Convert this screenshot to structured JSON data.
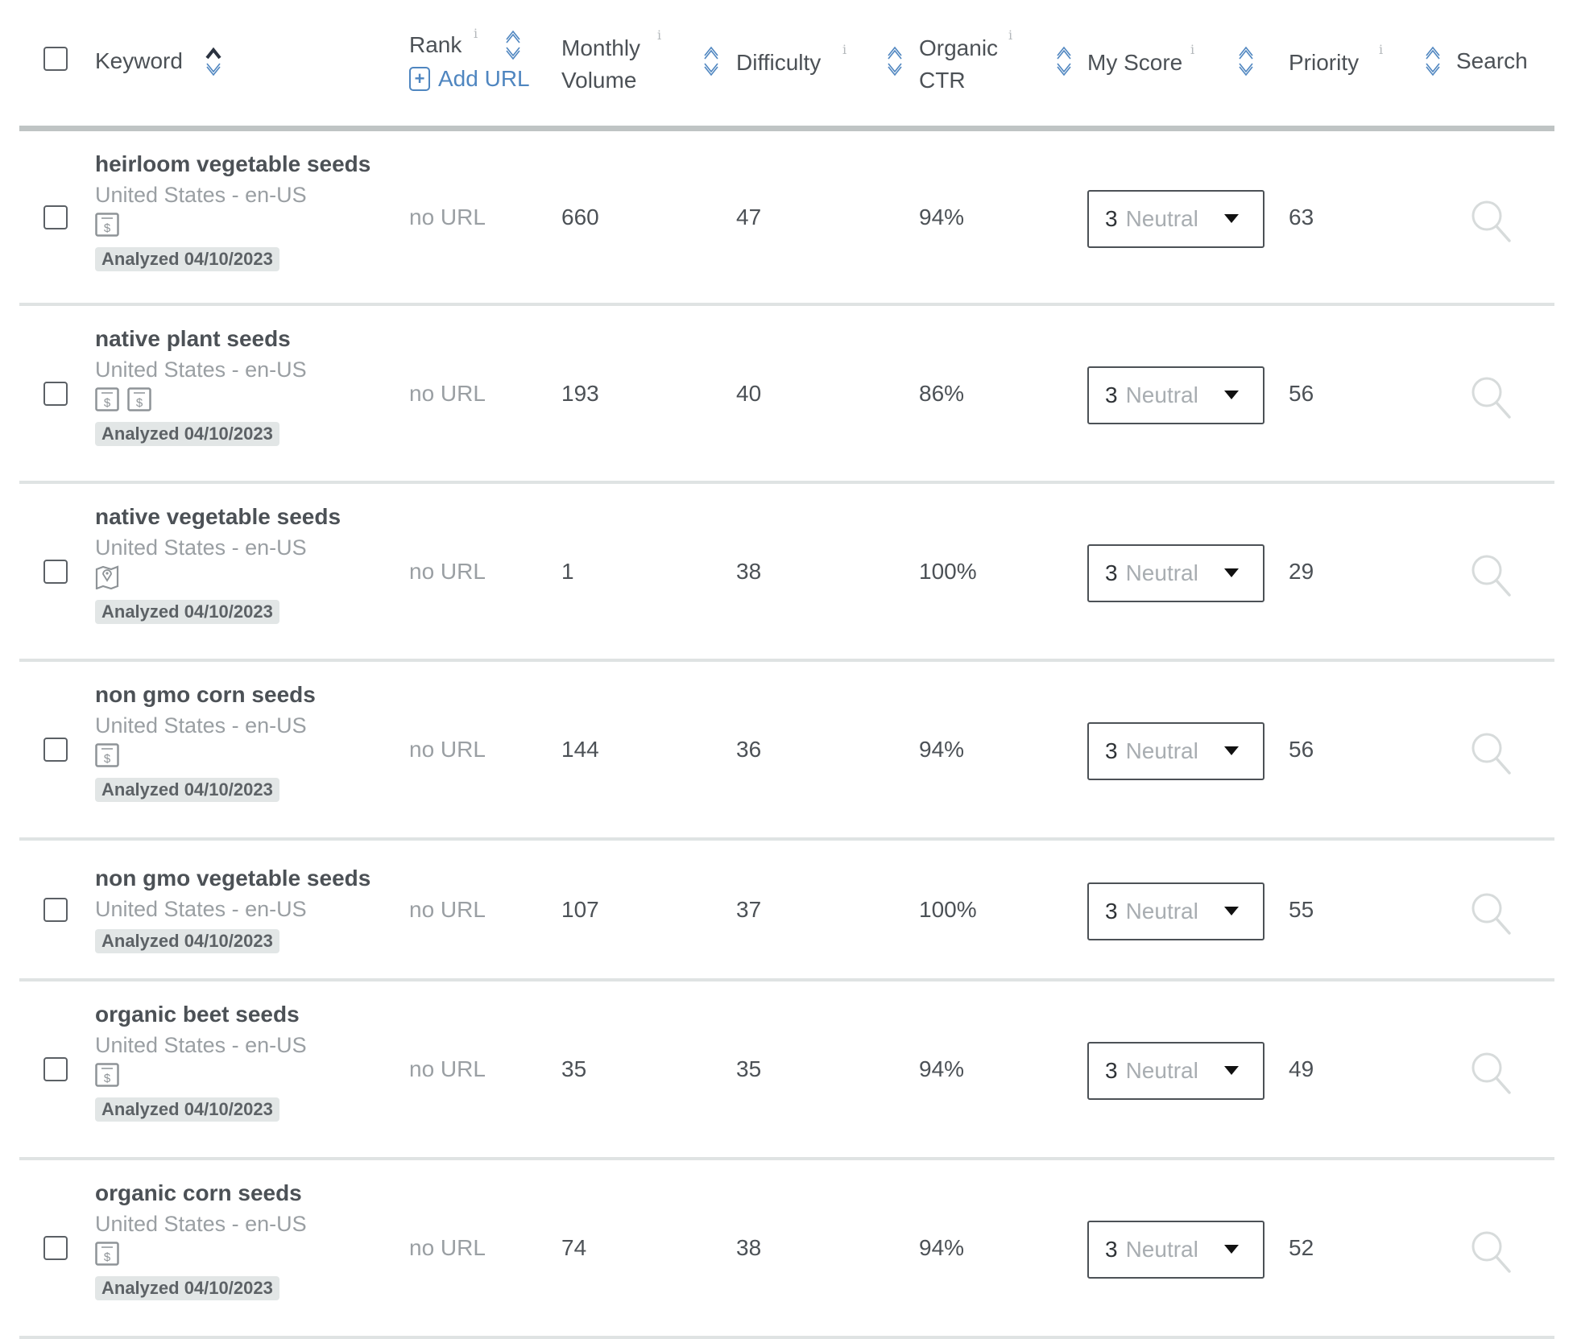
{
  "header": {
    "keyword": "Keyword",
    "rank": "Rank",
    "add_url": "Add URL",
    "monthly_volume_1": "Monthly",
    "monthly_volume_2": "Volume",
    "difficulty": "Difficulty",
    "organic_ctr_1": "Organic",
    "organic_ctr_2": "CTR",
    "my_score": "My Score",
    "priority": "Priority",
    "search": "Search",
    "info": "i"
  },
  "colors": {
    "accent": "#4f86c0",
    "text": "#4c5156",
    "muted": "#9a9fa3",
    "badge_bg": "#e2e6e6"
  },
  "rows": [
    {
      "keyword": "heirloom vegetable seeds",
      "locale": "United States - en-US",
      "icons": [
        "dollar-icon"
      ],
      "analyzed": "Analyzed 04/10/2023",
      "rank": "no URL",
      "volume": "660",
      "difficulty": "47",
      "ctr": "94%",
      "score_num": "3",
      "score_label": "Neutral",
      "priority": "63"
    },
    {
      "keyword": "native plant seeds",
      "locale": "United States - en-US",
      "icons": [
        "dollar-icon",
        "dollar-icon"
      ],
      "analyzed": "Analyzed 04/10/2023",
      "rank": "no URL",
      "volume": "193",
      "difficulty": "40",
      "ctr": "86%",
      "score_num": "3",
      "score_label": "Neutral",
      "priority": "56"
    },
    {
      "keyword": "native vegetable seeds",
      "locale": "United States - en-US",
      "icons": [
        "map-icon"
      ],
      "analyzed": "Analyzed 04/10/2023",
      "rank": "no URL",
      "volume": "1",
      "difficulty": "38",
      "ctr": "100%",
      "score_num": "3",
      "score_label": "Neutral",
      "priority": "29"
    },
    {
      "keyword": "non gmo corn seeds",
      "locale": "United States - en-US",
      "icons": [
        "dollar-icon"
      ],
      "analyzed": "Analyzed 04/10/2023",
      "rank": "no URL",
      "volume": "144",
      "difficulty": "36",
      "ctr": "94%",
      "score_num": "3",
      "score_label": "Neutral",
      "priority": "56"
    },
    {
      "keyword": "non gmo vegetable seeds",
      "locale": "United States - en-US",
      "icons": [],
      "analyzed": "Analyzed 04/10/2023",
      "rank": "no URL",
      "volume": "107",
      "difficulty": "37",
      "ctr": "100%",
      "score_num": "3",
      "score_label": "Neutral",
      "priority": "55"
    },
    {
      "keyword": "organic beet seeds",
      "locale": "United States - en-US",
      "icons": [
        "dollar-icon"
      ],
      "analyzed": "Analyzed 04/10/2023",
      "rank": "no URL",
      "volume": "35",
      "difficulty": "35",
      "ctr": "94%",
      "score_num": "3",
      "score_label": "Neutral",
      "priority": "49"
    },
    {
      "keyword": "organic corn seeds",
      "locale": "United States - en-US",
      "icons": [
        "dollar-icon"
      ],
      "analyzed": "Analyzed 04/10/2023",
      "rank": "no URL",
      "volume": "74",
      "difficulty": "38",
      "ctr": "94%",
      "score_num": "3",
      "score_label": "Neutral",
      "priority": "52"
    }
  ]
}
